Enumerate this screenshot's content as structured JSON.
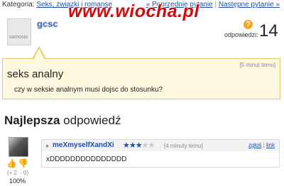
{
  "topbar": {
    "category_label": "Kategoria:",
    "category_link": "Seks, związki i romanse",
    "prev_link": "« Poprzednie pytanie",
    "separator": "|",
    "next_link": "Następne pytanie »"
  },
  "watermark": "www.wiocha.pl",
  "asker": {
    "avatar_text": "samosia",
    "name": "gcsc"
  },
  "stats": {
    "answers_label": "odpowiedzi:",
    "answers_count": "14"
  },
  "question": {
    "time": "[5 minut temu]",
    "title": "seks analny",
    "body": "czy w seksie analnym musi dojsc do stosunku?"
  },
  "best_answer": {
    "heading_bold": "Najlepsza",
    "heading_rest": " odpowiedź",
    "author": "meXmyselfXandXi",
    "rating": 3,
    "rating_max": 5,
    "time": "[4 minuty temu]",
    "report_link": "zgłoś",
    "link_link": "link",
    "text": "xDDDDDDDDDDDDDDD",
    "votes_plus": "(+ 2",
    "votes_minus": "- 0)",
    "percent": "100%"
  },
  "colors": {
    "link": "#1f4fa8",
    "watermark": "#d10a0a",
    "question_bg": "#fff8e0",
    "question_border": "#e8c867"
  }
}
